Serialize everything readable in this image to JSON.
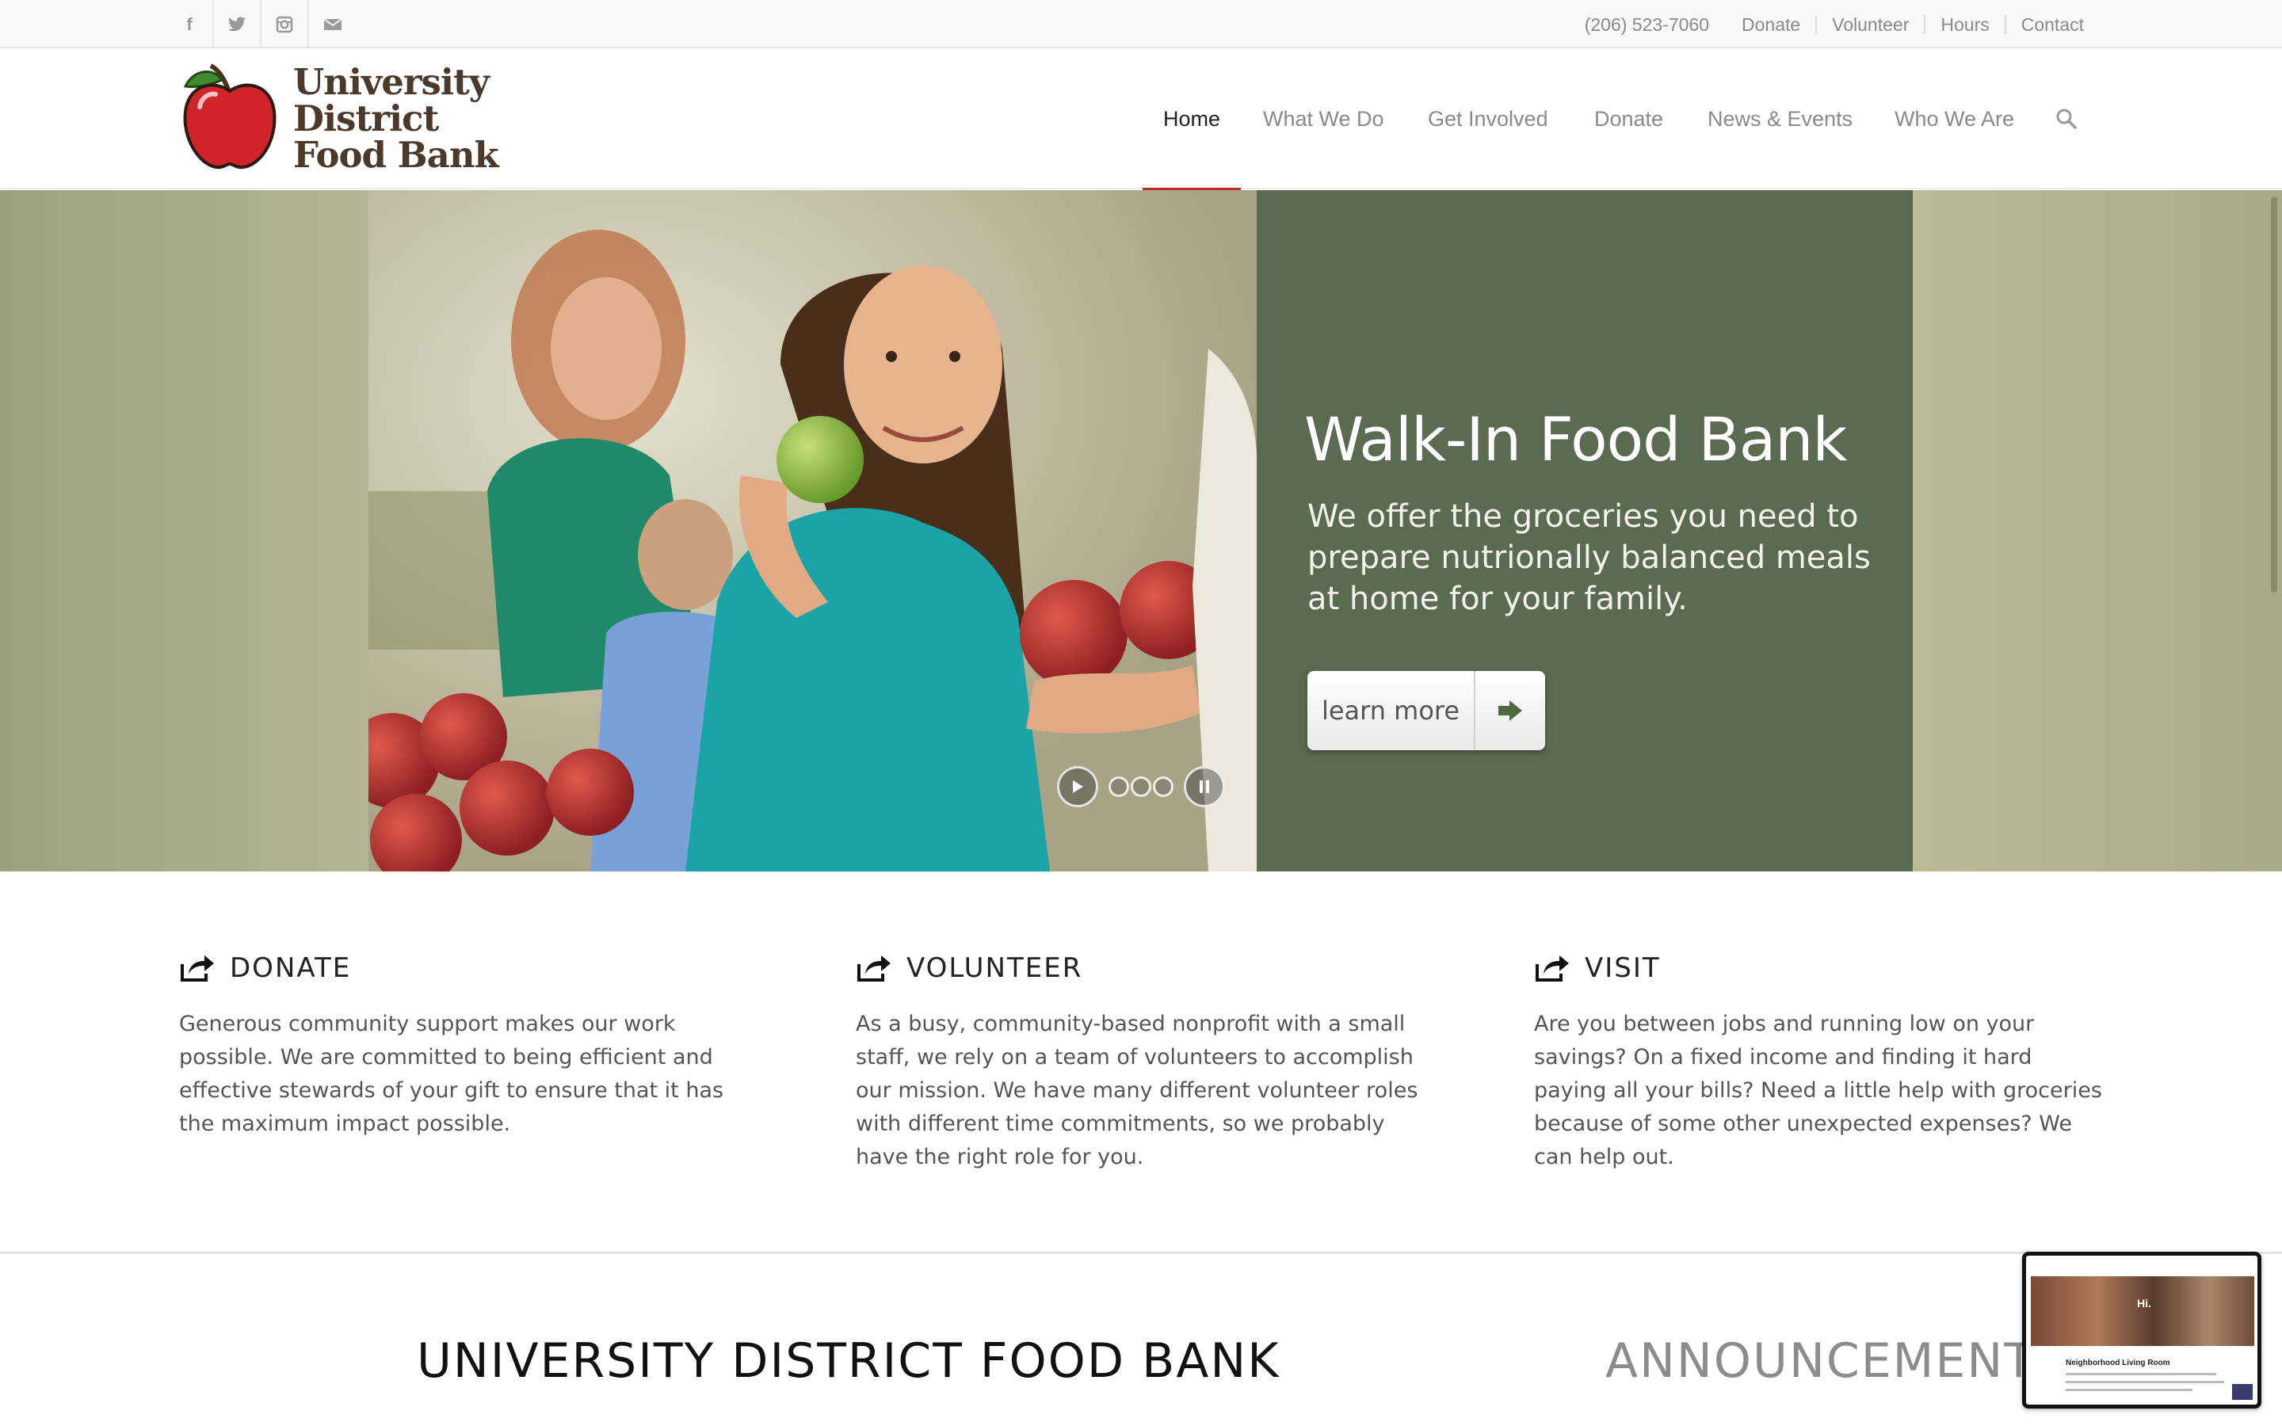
{
  "topbar": {
    "social": [
      {
        "icon": "facebook-icon",
        "glyph": "f"
      },
      {
        "icon": "twitter-icon",
        "glyph": "t"
      },
      {
        "icon": "instagram-icon",
        "glyph": "◎"
      },
      {
        "icon": "mail-icon",
        "glyph": "✉"
      }
    ],
    "phone": "(206) 523-7060",
    "links": [
      "Donate",
      "Volunteer",
      "Hours",
      "Contact"
    ]
  },
  "header": {
    "logo_lines": [
      "University",
      "District",
      "Food Bank"
    ],
    "nav": [
      "Home",
      "What We Do",
      "Get Involved",
      "Donate",
      "News & Events",
      "Who We Are"
    ],
    "active_nav": "Home",
    "accent_color": "#c0292c"
  },
  "hero": {
    "title": "Walk-In Food Bank",
    "subtitle": "We offer the groceries you need to prepare nutrionally balanced meals at home for your family.",
    "button_label": "learn more",
    "panel_color": "#5b6b51",
    "slide_count": 3
  },
  "columns": [
    {
      "title": "DONATE",
      "body": "Generous community support makes our work possible. We are committed to being efficient and effective stewards of your gift to ensure that it has the maximum impact possible."
    },
    {
      "title": "VOLUNTEER",
      "body": "As a busy, community-based nonprofit with a small staff, we rely on a team of volunteers to accomplish our mission. We have many different volunteer roles with different time commitments, so we probably have the right role for you."
    },
    {
      "title": "VISIT",
      "body": "Are you between jobs and running low on your savings? On a fixed income and finding it hard paying all your bills? Need a little help with groceries because of some other unexpected expenses? We can help out."
    }
  ],
  "bottom": {
    "title": "UNIVERSITY DISTRICT FOOD BANK",
    "announcements": "ANNOUNCEMENTS"
  },
  "video_thumb": {
    "hi_text": "Hi.",
    "caption": "Neighborhood Living Room"
  }
}
